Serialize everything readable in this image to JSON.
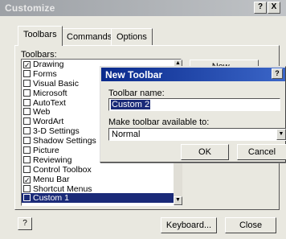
{
  "window": {
    "title": "Customize",
    "help_label": "?",
    "close_label": "X"
  },
  "tabs": [
    {
      "label": "Toolbars"
    },
    {
      "label": "Commands"
    },
    {
      "label": "Options"
    }
  ],
  "toolbars_label": "Toolbars:",
  "toolbars": [
    {
      "label": "Drawing",
      "checked": true
    },
    {
      "label": "Forms",
      "checked": false
    },
    {
      "label": "Visual Basic",
      "checked": false
    },
    {
      "label": "Microsoft",
      "checked": false
    },
    {
      "label": "AutoText",
      "checked": false
    },
    {
      "label": "Web",
      "checked": false
    },
    {
      "label": "WordArt",
      "checked": false
    },
    {
      "label": "3-D Settings",
      "checked": false
    },
    {
      "label": "Shadow Settings",
      "checked": false
    },
    {
      "label": "Picture",
      "checked": false
    },
    {
      "label": "Reviewing",
      "checked": false
    },
    {
      "label": "Control Toolbox",
      "checked": false
    },
    {
      "label": "Menu Bar",
      "checked": true
    },
    {
      "label": "Shortcut Menus",
      "checked": false
    },
    {
      "label": "Custom 1",
      "checked": false,
      "selected": true
    }
  ],
  "side_button": "New...",
  "footer": {
    "help_icon": "?",
    "keyboard_label": "Keyboard...",
    "close_label": "Close"
  },
  "new_toolbar_dialog": {
    "title": "New Toolbar",
    "help_label": "?",
    "name_label": "Toolbar name:",
    "name_value": "Custom 2",
    "available_label": "Make toolbar available to:",
    "available_value": "Normal",
    "ok_label": "OK",
    "cancel_label": "Cancel"
  }
}
